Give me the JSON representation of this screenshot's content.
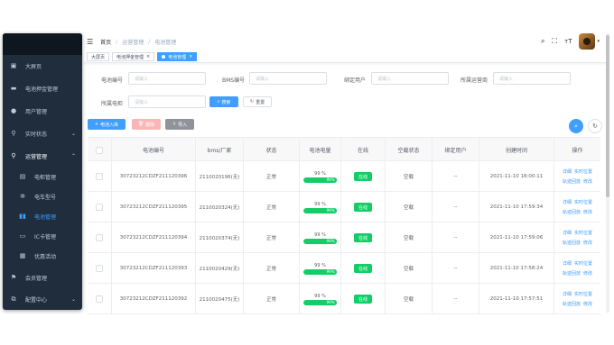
{
  "sidebar": {
    "items": [
      {
        "label": "大屏页",
        "icon": "dashboard-icon"
      },
      {
        "label": "电池押金管理",
        "icon": "card-icon"
      },
      {
        "label": "用户管理",
        "icon": "user-icon"
      },
      {
        "label": "实时状态",
        "icon": "location-icon"
      },
      {
        "label": "运营管理",
        "icon": "location-icon"
      },
      {
        "label": "电柜管理",
        "icon": "cabinet-icon"
      },
      {
        "label": "电车型号",
        "icon": "settings-icon"
      },
      {
        "label": "电池管理",
        "icon": "battery-icon"
      },
      {
        "label": "IC卡管理",
        "icon": "ic-card-icon"
      },
      {
        "label": "优惠活动",
        "icon": "gift-icon"
      },
      {
        "label": "会员管理",
        "icon": "member-icon"
      },
      {
        "label": "配置中心",
        "icon": "config-icon"
      }
    ]
  },
  "header": {
    "breadcrumb": [
      "首页",
      "运营管理",
      "电池管理"
    ]
  },
  "tags": [
    {
      "label": "大屏页"
    },
    {
      "label": "电池押金管理"
    },
    {
      "label": "电池管理"
    }
  ],
  "filters": {
    "battery_no_label": "电池编号",
    "battery_no_placeholder": "请输入",
    "bms_label": "BMS编号",
    "bms_placeholder": "请输入",
    "bound_user_label": "绑定用户",
    "bound_user_placeholder": "请输入",
    "operator_label": "所属运营商",
    "operator_placeholder": "请输入",
    "cabinet_label": "所属电柜",
    "cabinet_placeholder": "请输入",
    "search_label": "搜索",
    "reset_label": "重置"
  },
  "toolbar": {
    "add_label": "电池入库",
    "delete_label": "删除",
    "import_label": "导入"
  },
  "table": {
    "columns": [
      "电池编号",
      "bms/厂家",
      "状态",
      "电池电量",
      "在线",
      "空载状态",
      "绑定用户",
      "创建时间",
      "操作"
    ],
    "rows": [
      {
        "battery_no": "30723212CDZF211120396",
        "bms": "2110020196(无)",
        "status": "正常",
        "power_text": "99 %",
        "power_inner": "99%",
        "power": 99,
        "online": "在线",
        "load": "空载",
        "user": "--",
        "created": "2021-11-10 18:00:11"
      },
      {
        "battery_no": "30723212CDZF211120395",
        "bms": "2110020324(无)",
        "status": "正常",
        "power_text": "99 %",
        "power_inner": "99%",
        "power": 99,
        "online": "在线",
        "load": "空载",
        "user": "--",
        "created": "2021-11-10 17:59:34"
      },
      {
        "battery_no": "30723212CDZF211120394",
        "bms": "2110020374(无)",
        "status": "正常",
        "power_text": "99 %",
        "power_inner": "99%",
        "power": 99,
        "online": "在线",
        "load": "空载",
        "user": "--",
        "created": "2021-11-10 17:59:06"
      },
      {
        "battery_no": "30723212CDZF211120393",
        "bms": "2110020429(无)",
        "status": "正常",
        "power_text": "99 %",
        "power_inner": "99%",
        "power": 99,
        "online": "在线",
        "load": "空载",
        "user": "--",
        "created": "2021-11-10 17:58:24"
      },
      {
        "battery_no": "30723212CDZF211120392",
        "bms": "2110020475(无)",
        "status": "正常",
        "power_text": "99 %",
        "power_inner": "99%",
        "power": 99,
        "online": "在线",
        "load": "空载",
        "user": "--",
        "created": "2021-11-10 17:57:51"
      }
    ],
    "actions": {
      "detail": "详细",
      "realtime": "实时位置",
      "track": "轨迹回放",
      "edit": "修改"
    }
  },
  "colors": {
    "primary": "#409eff",
    "success": "#13ce66",
    "sidebar": "#1f2d3d"
  }
}
